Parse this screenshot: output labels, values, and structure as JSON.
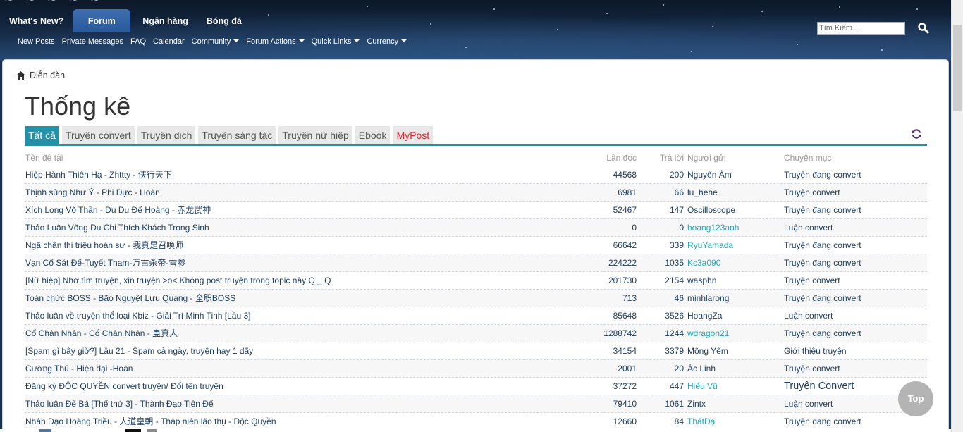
{
  "nav": {
    "tabs": [
      {
        "label": "What's New?"
      },
      {
        "label": "Forum"
      },
      {
        "label": "Ngân hàng"
      },
      {
        "label": "Bóng đá"
      }
    ],
    "subnav": [
      {
        "label": "New Posts",
        "dropdown": false
      },
      {
        "label": "Private Messages",
        "dropdown": false
      },
      {
        "label": "FAQ",
        "dropdown": false
      },
      {
        "label": "Calendar",
        "dropdown": false
      },
      {
        "label": "Community",
        "dropdown": true
      },
      {
        "label": "Forum Actions",
        "dropdown": true
      },
      {
        "label": "Quick Links",
        "dropdown": true
      },
      {
        "label": "Currency",
        "dropdown": true
      }
    ],
    "search_placeholder": "Tìm Kiếm..."
  },
  "breadcrumb": {
    "label": "Diễn đàn"
  },
  "page": {
    "title": "Thống kê"
  },
  "tabs": [
    {
      "label": "Tất cả"
    },
    {
      "label": "Truyện convert"
    },
    {
      "label": "Truyện dịch"
    },
    {
      "label": "Truyện sáng tác"
    },
    {
      "label": "Truyện nữ hiệp"
    },
    {
      "label": "Ebook"
    },
    {
      "label": "MyPost"
    }
  ],
  "table": {
    "headers": {
      "title": "Tên đề tài",
      "views": "Lần đọc",
      "replies": "Trả lời",
      "user": "Người gửi",
      "category": "Chuyên mục"
    },
    "rows": [
      {
        "title": "Hiệp Hành Thiên Hạ - Zhttty - 侠行天下",
        "views": "44568",
        "replies": "200",
        "user": "Nguyên Âm",
        "category": "Truyện đang convert"
      },
      {
        "title": "Thịnh sủng Như Ý - Phi Dực - Hoàn",
        "views": "6981",
        "replies": "66",
        "user": "lu_hehe",
        "category": "Truyện convert"
      },
      {
        "title": "Xích Long Võ Thần - Du Du Đế Hoàng - 赤龙武神",
        "views": "52467",
        "replies": "147",
        "user": "Oscilloscope",
        "category": "Truyện đang convert"
      },
      {
        "title": "Thảo Luận Võng Du Chi Thích Khách Trọng Sinh",
        "views": "0",
        "replies": "0",
        "user": "hoang123anh",
        "category": "Luận convert"
      },
      {
        "title": "Ngã chân thị triệu hoán sư - 我真是召唤师",
        "views": "66642",
        "replies": "339",
        "user": "RyuYamada",
        "category": "Truyện đang convert"
      },
      {
        "title": "Vạn Cổ Sát Đế-Tuyết Tham-万古杀帝-雪参",
        "views": "224222",
        "replies": "1035",
        "user": "Kc3a090",
        "category": "Truyện đang convert"
      },
      {
        "title": "[Nữ hiệp] Nhờ tìm truyện, xin truyện >o< Không post truyện trong topic này Q _ Q",
        "views": "201730",
        "replies": "2154",
        "user": "wasphn",
        "category": "Truyện convert"
      },
      {
        "title": "Toàn chức BOSS - Bão Nguyệt Lưu Quang - 全职BOSS",
        "views": "713",
        "replies": "46",
        "user": "minhlarong",
        "category": "Truyện đang convert"
      },
      {
        "title": "Thảo luận về truyện thể loại Kbiz - Giải Trí Minh Tinh [Lầu 3]",
        "views": "85648",
        "replies": "3526",
        "user": "HoangZa",
        "category": "Luận convert"
      },
      {
        "title": "Cổ Chân Nhân - Cổ Chân Nhân - 蛊真人",
        "views": "1288742",
        "replies": "1244",
        "user": "wdragon21",
        "category": "Truyện đang convert"
      },
      {
        "title": "[Spam gì bây giờ?] Lầu 21 - Spam cả ngày, truyện hay 1 dãy",
        "views": "34154",
        "replies": "3379",
        "user": "Mộng Yểm",
        "category": "Giới thiệu truyện"
      },
      {
        "title": "Cường Thú - Hiện đại -Hoàn",
        "views": "2001",
        "replies": "20",
        "user": "Ác Linh",
        "category": "Truyện convert"
      },
      {
        "title": "Đăng ký ĐỘC QUYỀN convert truyện/ Đổi tên truyện",
        "views": "37272",
        "replies": "447",
        "user": "Hiểu Vũ",
        "category": "Truyện Convert"
      },
      {
        "title": "Thảo luận Đế Bá [Thế thứ 3] - Thành Đạo Tiên Đế",
        "views": "79410",
        "replies": "1061",
        "user": "Zintx",
        "category": "Luận convert"
      },
      {
        "title": "Nhân Đạo Hoàng Triều - 人道皇朝 - Thập niên lão thụ - Độc Quyền",
        "views": "12660",
        "replies": "84",
        "user": "ThấtDạ",
        "category": "Truyện đang convert"
      }
    ]
  },
  "top_button": {
    "label": "Top"
  },
  "colors": {
    "accent": "#2391a8",
    "link": "#1d3e63",
    "user_teal": "#24a8b8",
    "mypost_red": "#e8202a"
  }
}
